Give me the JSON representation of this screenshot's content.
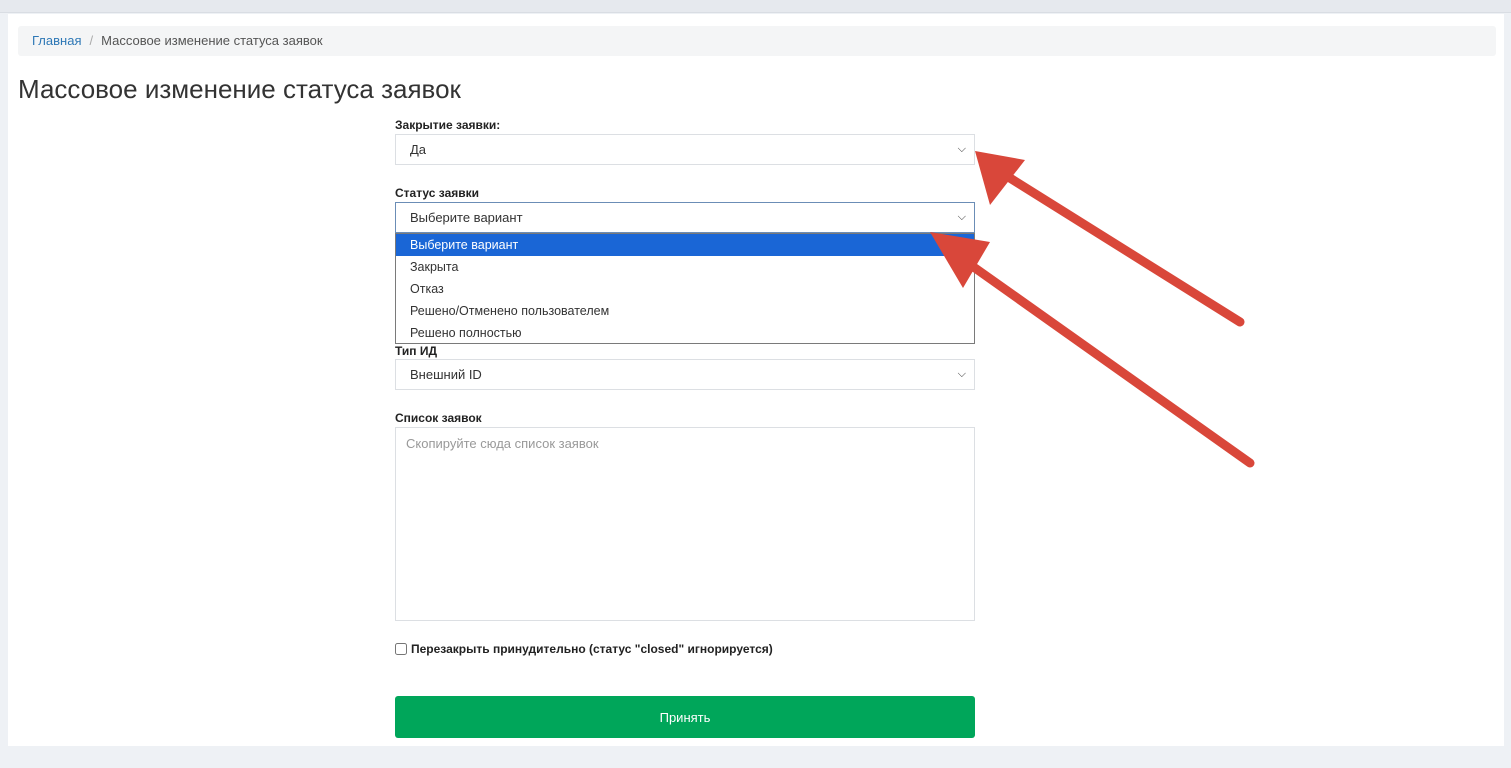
{
  "breadcrumb": {
    "home": "Главная",
    "current": "Массовое изменение статуса заявок"
  },
  "page_title": "Массовое изменение статуса заявок",
  "form": {
    "closing": {
      "label": "Закрытие заявки:",
      "value": "Да"
    },
    "status": {
      "label": "Статус заявки",
      "value": "Выберите вариант",
      "options": [
        "Выберите вариант",
        "Закрыта",
        "Отказ",
        "Решено/Отменено пользователем",
        "Решено полностью"
      ]
    },
    "id_type": {
      "label": "Тип ИД",
      "value": "Внешний ID"
    },
    "request_list": {
      "label": "Список заявок",
      "placeholder": "Скопируйте сюда список заявок"
    },
    "force_reclose": {
      "label": "Перезакрыть принудительно (статус \"closed\" игнорируется)",
      "checked": false
    },
    "submit_label": "Принять"
  },
  "colors": {
    "accent_link": "#2e78b6",
    "submit_bg": "#00a65a",
    "selected_option": "#1a66d6",
    "annotation_arrow": "#d9473a"
  }
}
